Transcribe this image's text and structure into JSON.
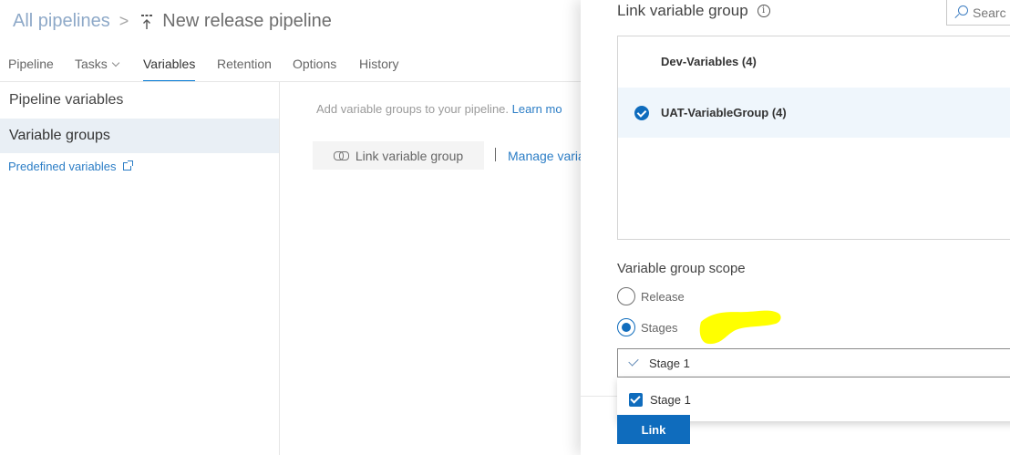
{
  "header": {
    "breadcrumb_root": "All pipelines",
    "separator": ">",
    "title": "New release pipeline"
  },
  "tabs": [
    {
      "label": "Pipeline"
    },
    {
      "label": "Tasks"
    },
    {
      "label": "Variables"
    },
    {
      "label": "Retention"
    },
    {
      "label": "Options"
    },
    {
      "label": "History"
    }
  ],
  "left_nav": {
    "pipeline_variables": "Pipeline variables",
    "variable_groups": "Variable groups",
    "predefined_variables": "Predefined variables"
  },
  "content": {
    "hint": "Add variable groups to your pipeline.",
    "learn_more": "Learn mo",
    "link_button": "Link variable group",
    "manage_link": "Manage varia"
  },
  "panel": {
    "title": "Link variable group",
    "info_glyph": "i",
    "search_placeholder": "Searc",
    "groups": [
      {
        "name": "Dev-Variables (4)",
        "selected": false
      },
      {
        "name": "UAT-VariableGroup (4)",
        "selected": true
      }
    ],
    "scope_label": "Variable group scope",
    "scope_options": [
      {
        "label": "Release",
        "checked": false
      },
      {
        "label": "Stages",
        "checked": true
      }
    ],
    "dropdown_value": "Stage 1",
    "dropdown_options": [
      {
        "label": "Stage 1",
        "checked": true
      }
    ],
    "link_button": "Link"
  },
  "colors": {
    "accent": "#0f6cbd",
    "link": "#2b7dc6",
    "highlight": "#ffff00",
    "selected_row": "#eff6fc"
  },
  "icons": [
    "pipeline-icon",
    "chevron-down-icon",
    "external-link-icon",
    "chain-link-icon",
    "info-icon",
    "search-icon",
    "check-circle-icon",
    "check-icon",
    "checkbox-icon"
  ]
}
